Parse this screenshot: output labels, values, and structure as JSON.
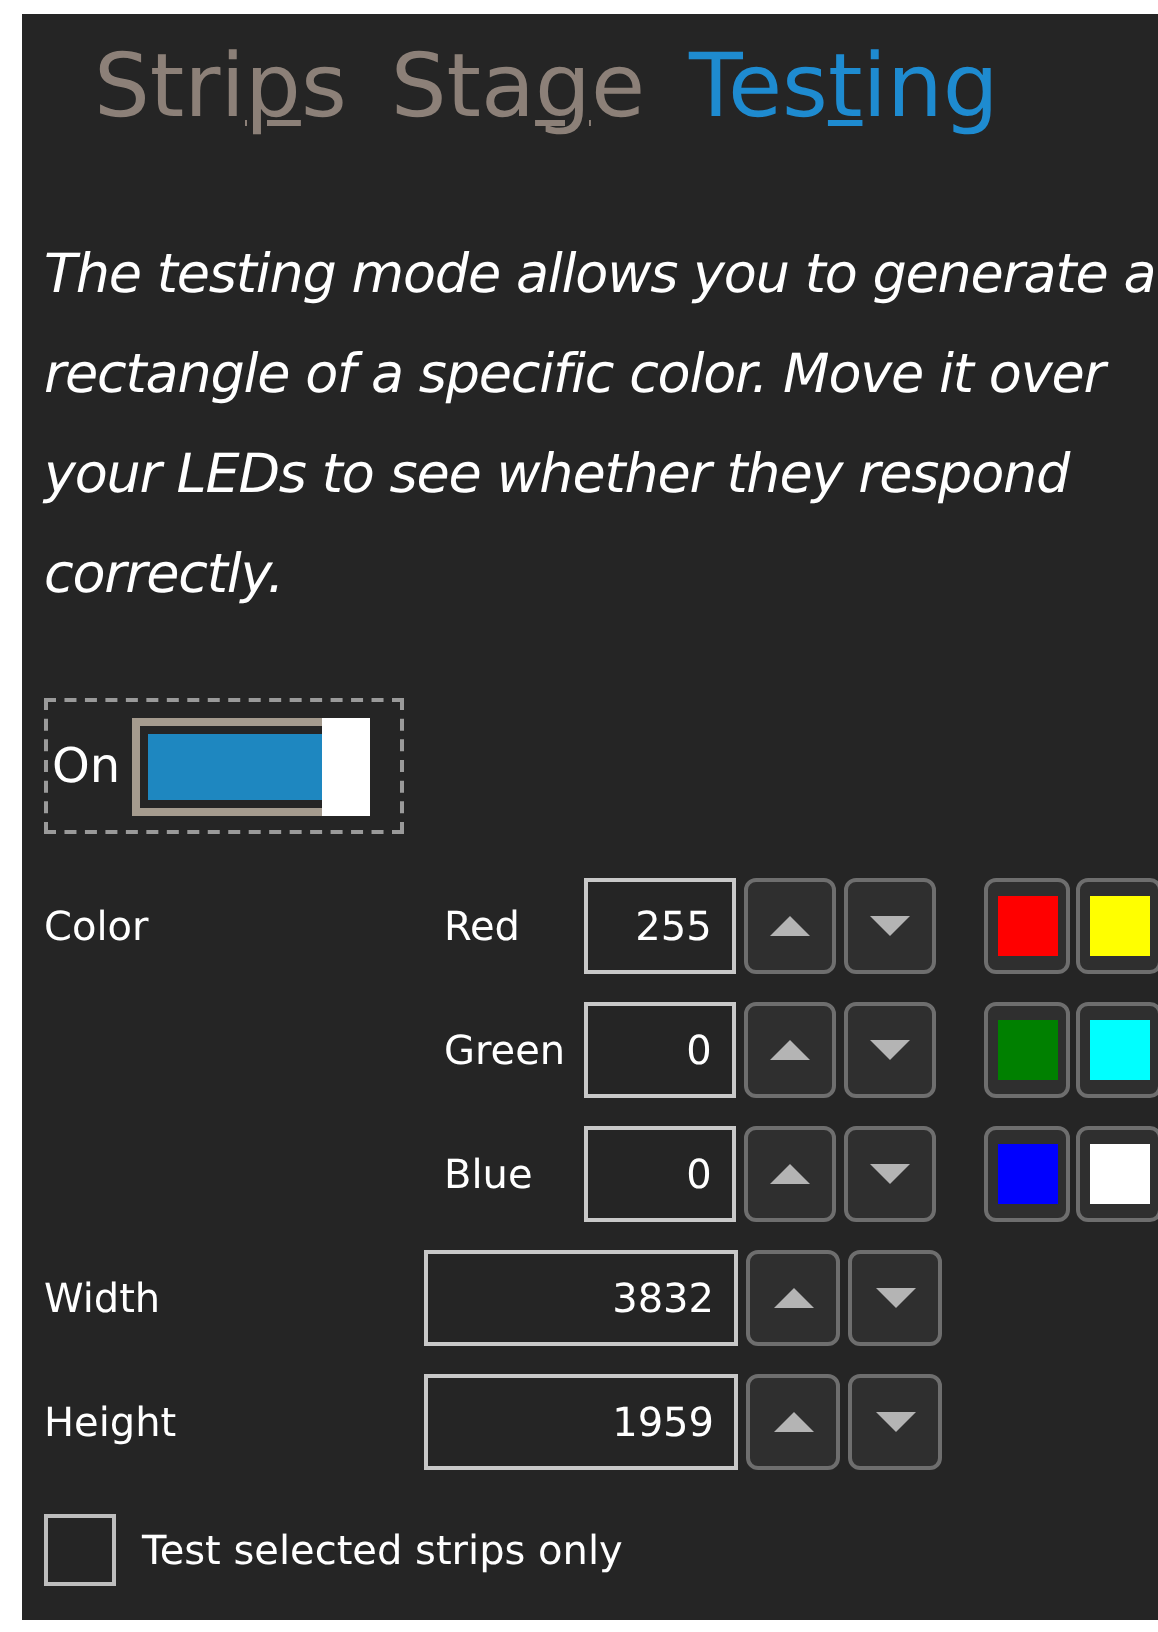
{
  "tabs": [
    {
      "text_before": "Stri",
      "access_key": "p",
      "text_after": "s",
      "selected": false
    },
    {
      "text_before": "Sta",
      "access_key": "g",
      "text_after": "e",
      "selected": false
    },
    {
      "text_before": "Tes",
      "access_key": "t",
      "text_after": "ing",
      "selected": true
    }
  ],
  "description": "The testing mode allows you to generate a rectangle of a specific color. Move it over your LEDs to see whether they respond correctly.",
  "toggle": {
    "label": "On",
    "on": true
  },
  "color": {
    "label": "Color",
    "channels": [
      {
        "name": "Red",
        "value": "255"
      },
      {
        "name": "Green",
        "value": "0"
      },
      {
        "name": "Blue",
        "value": "0"
      }
    ]
  },
  "swatches": [
    {
      "color": "#ff0000"
    },
    {
      "color": "#ffff00"
    },
    {
      "color": "#008000"
    },
    {
      "color": "#00ffff"
    },
    {
      "color": "#0000ff"
    },
    {
      "color": "#ffffff"
    }
  ],
  "size_fields": [
    {
      "label": "Width",
      "value": "3832"
    },
    {
      "label": "Height",
      "value": "1959"
    }
  ],
  "checkbox": {
    "label": "Test selected strips only",
    "checked": false
  }
}
